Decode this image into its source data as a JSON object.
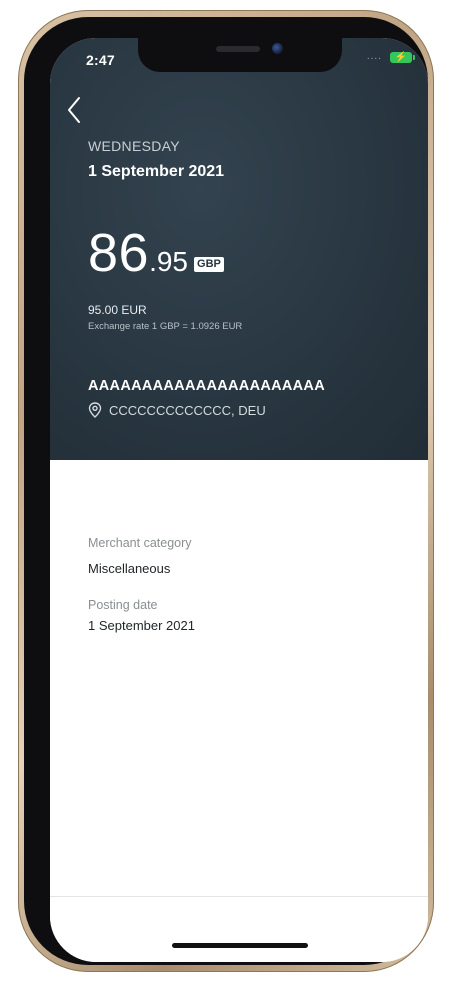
{
  "status_bar": {
    "time": "2:47",
    "signal_dots": "....",
    "battery_icon": "battery-charging-icon",
    "battery_color": "#34c759"
  },
  "header": {
    "back_icon": "chevron-left-icon",
    "weekday": "WEDNESDAY",
    "date": "1 September 2021"
  },
  "transaction": {
    "amount_integer": "86",
    "amount_decimal": ".95",
    "currency": "GBP",
    "converted_amount": "95.00 EUR",
    "exchange_rate": "Exchange rate 1 GBP = 1.0926 EUR",
    "merchant_name": "AAAAAAAAAAAAAAAAAAAAAA",
    "location_icon": "location-pin-icon",
    "location": "CCCCCCCCCCCCC, DEU"
  },
  "details": {
    "merchant_category_label": "Merchant category",
    "merchant_category_value": "Miscellaneous",
    "posting_date_label": "Posting date",
    "posting_date_value": "1 September 2021"
  },
  "colors": {
    "header_background": "#2b3a45",
    "frame_gold": "#bfa584"
  }
}
